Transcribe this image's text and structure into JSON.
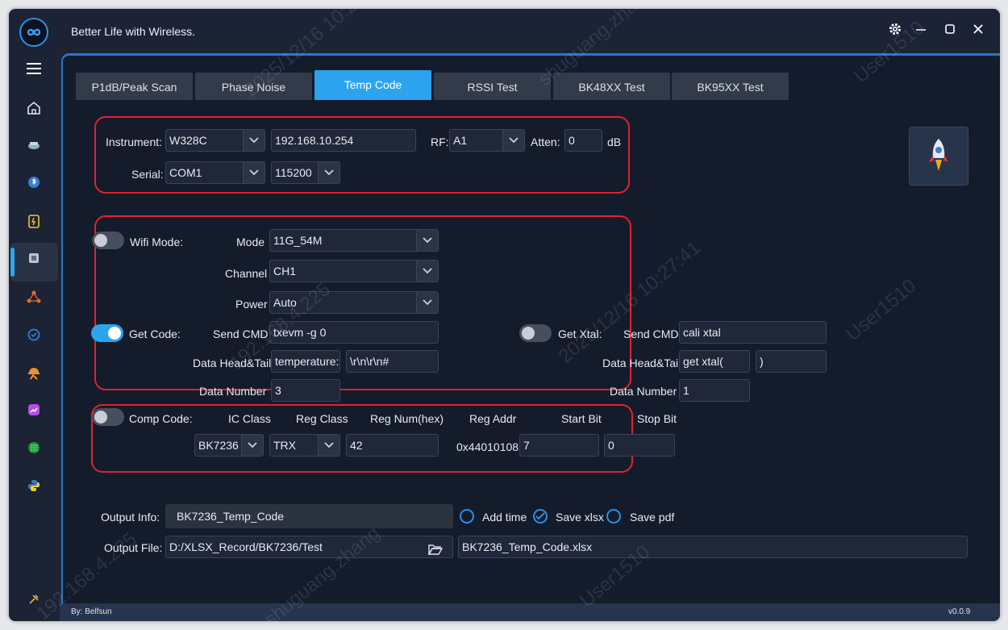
{
  "titlebar": {
    "title": "Better Life with Wireless."
  },
  "tabs": [
    {
      "label": "P1dB/Peak Scan"
    },
    {
      "label": "Phase Noise"
    },
    {
      "label": "Temp Code"
    },
    {
      "label": "RSSI Test"
    },
    {
      "label": "BK48XX Test"
    },
    {
      "label": "BK95XX Test"
    }
  ],
  "instrument": {
    "instrument_label": "Instrument:",
    "instrument_value": "W328C",
    "ip_value": "192.168.10.254",
    "rf_label": "RF:",
    "rf_value": "A1",
    "atten_label": "Atten:",
    "atten_value": "0",
    "atten_unit": "dB",
    "serial_label": "Serial:",
    "serial_value": "COM1",
    "baud_value": "115200"
  },
  "wifi": {
    "wifi_mode_label": "Wifi Mode:",
    "mode_label": "Mode",
    "mode_value": "11G_54M",
    "channel_label": "Channel",
    "channel_value": "CH1",
    "power_label": "Power",
    "power_value": "Auto"
  },
  "get_code": {
    "label": "Get Code:",
    "send_cmd_label": "Send CMD",
    "send_cmd_value": "txevm -g 0",
    "head_tail_label": "Data Head&Tail",
    "head_value": "temperature:",
    "tail_value": "\\r\\n\\r\\n#",
    "data_number_label": "Data Number",
    "data_number_value": "3"
  },
  "get_xtal": {
    "label": "Get Xtal:",
    "send_cmd_label": "Send CMD",
    "send_cmd_value": "cali xtal",
    "head_tail_label": "Data Head&Tail",
    "head_value": "get xtal(",
    "tail_value": ")",
    "data_number_label": "Data Number",
    "data_number_value": "1"
  },
  "comp_code": {
    "label": "Comp Code:",
    "ic_class_label": "IC Class",
    "ic_class_value": "BK7236",
    "reg_class_label": "Reg Class",
    "reg_class_value": "TRX",
    "reg_num_label": "Reg Num(hex)",
    "reg_num_value": "42",
    "reg_addr_label": "Reg Addr",
    "reg_addr_value": "0x44010108",
    "start_bit_label": "Start Bit",
    "start_bit_value": "7",
    "stop_bit_label": "Stop Bit",
    "stop_bit_value": "0"
  },
  "output": {
    "info_label": "Output Info:",
    "info_value": "BK7236_Temp_Code",
    "add_time_label": "Add time",
    "save_xlsx_label": "Save xlsx",
    "save_pdf_label": "Save pdf",
    "file_label": "Output File:",
    "file_path": "D:/XLSX_Record/BK7236/Test",
    "file_name": "BK7236_Temp_Code.xlsx"
  },
  "footer": {
    "author": "By: Belfsun",
    "version": "v0.0.9"
  },
  "watermark": {
    "user": "User1510",
    "ip": "192.168.4.225",
    "date": "2025/12/16 10:27:41",
    "name": "shuguang.zhang"
  },
  "colors": {
    "accent": "#2ba3ee",
    "highlight_box": "#e0222f",
    "background": "#141c2c"
  }
}
